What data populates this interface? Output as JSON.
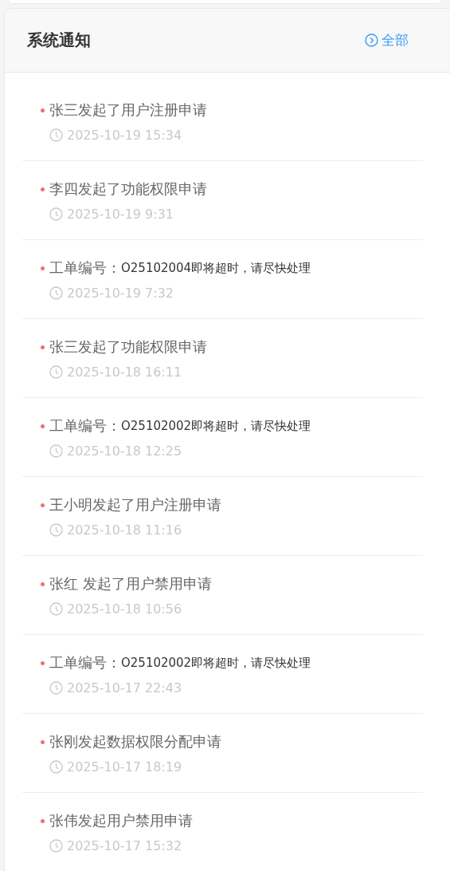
{
  "panel": {
    "title": "系统通知",
    "all_link": "全部"
  },
  "notifications": [
    {
      "kind": "plain",
      "text": "张三发起了用户注册申请",
      "time": "2025-10-19 15:34"
    },
    {
      "kind": "plain",
      "text": "李四发起了功能权限申请",
      "time": "2025-10-19 9:31"
    },
    {
      "kind": "ticket",
      "prefix": "工单编号：",
      "detail": "O25102004即将超时，请尽快处理",
      "time": "2025-10-19 7:32"
    },
    {
      "kind": "plain",
      "text": "张三发起了功能权限申请",
      "time": "2025-10-18 16:11"
    },
    {
      "kind": "ticket",
      "prefix": "工单编号：",
      "detail": "O25102002即将超时，请尽快处理",
      "time": "2025-10-18 12:25"
    },
    {
      "kind": "plain",
      "text": "王小明发起了用户注册申请",
      "time": "2025-10-18 11:16"
    },
    {
      "kind": "plain",
      "text": "张红 发起了用户禁用申请",
      "time": "2025-10-18 10:56"
    },
    {
      "kind": "ticket",
      "prefix": "工单编号：",
      "detail": "O25102002即将超时，请尽快处理",
      "time": "2025-10-17 22:43"
    },
    {
      "kind": "plain",
      "text": "张刚发起数据权限分配申请",
      "time": "2025-10-17 18:19"
    },
    {
      "kind": "plain",
      "text": "张伟发起用户禁用申请",
      "time": "2025-10-17 15:32"
    }
  ]
}
